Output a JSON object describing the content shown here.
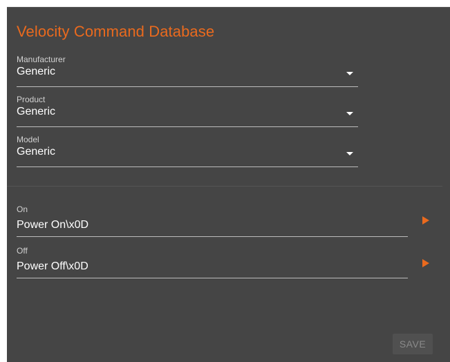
{
  "dialog": {
    "title": "Velocity Command Database"
  },
  "selects": [
    {
      "label": "Manufacturer",
      "value": "Generic"
    },
    {
      "label": "Product",
      "value": "Generic"
    },
    {
      "label": "Model",
      "value": "Generic"
    }
  ],
  "commands": [
    {
      "label": "On",
      "value": "Power On\\x0D"
    },
    {
      "label": "Off",
      "value": "Power Off\\x0D"
    }
  ],
  "actions": {
    "save_label": "SAVE"
  },
  "colors": {
    "accent": "#ea6a1e",
    "background": "#454545",
    "text": "#ffffff",
    "disabled_text": "#8a8a8a"
  },
  "icons": {
    "dropdown": "caret-down-icon",
    "send": "play-icon"
  }
}
